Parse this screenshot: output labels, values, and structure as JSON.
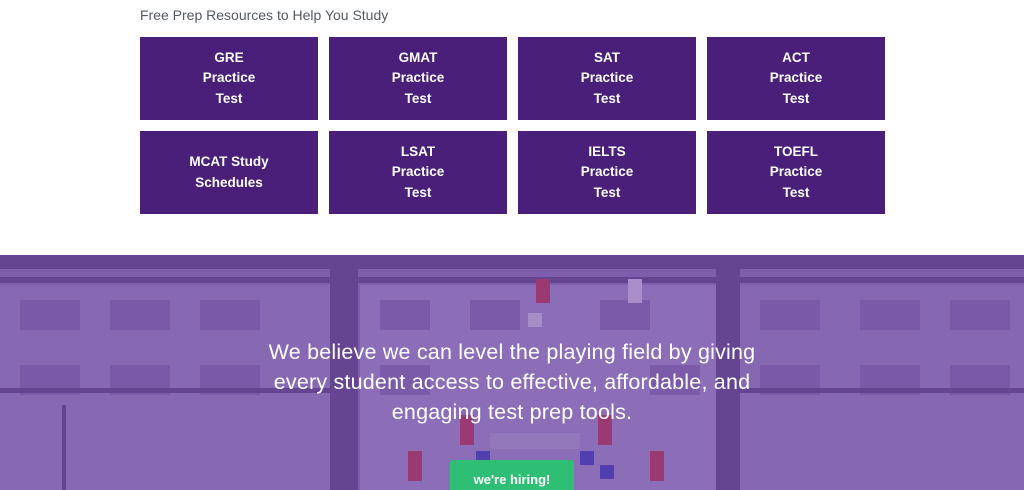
{
  "resources": {
    "heading": "Free Prep Resources to Help You Study",
    "tiles": [
      {
        "label": "GRE\nPractice\nTest"
      },
      {
        "label": "GMAT\nPractice\nTest"
      },
      {
        "label": "SAT\nPractice\nTest"
      },
      {
        "label": "ACT\nPractice\nTest"
      },
      {
        "label": "MCAT Study\nSchedules"
      },
      {
        "label": "LSAT\nPractice\nTest"
      },
      {
        "label": "IELTS\nPractice\nTest"
      },
      {
        "label": "TOEFL\nPractice\nTest"
      }
    ]
  },
  "hero": {
    "mission": "We believe we can level the playing field by giving every student access to effective, affordable, and engaging test prep tools.",
    "cta_label": "we're hiring!"
  },
  "colors": {
    "tile_bg": "#4a1f7a",
    "cta_bg": "#2fbf74",
    "hero_tint": "#7a5aa6"
  }
}
